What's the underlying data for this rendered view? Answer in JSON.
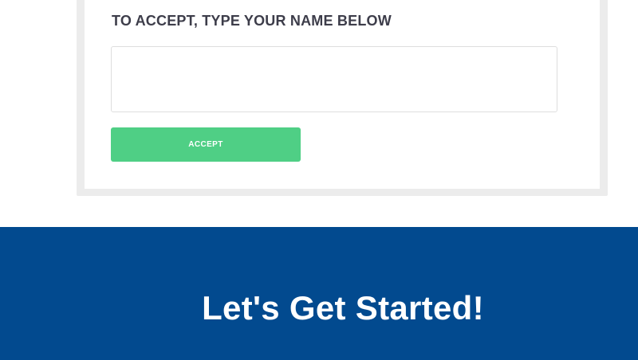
{
  "accept_form": {
    "heading": "TO ACCEPT, TYPE YOUR NAME BELOW",
    "name_input_value": "",
    "accept_button_label": "ACCEPT"
  },
  "cta_section": {
    "heading": "Let's Get Started!"
  },
  "colors": {
    "accept_button": "#4fcf85",
    "cta_background": "#024a8f",
    "card_frame": "#ececec",
    "heading_text": "#3d3d4a"
  }
}
